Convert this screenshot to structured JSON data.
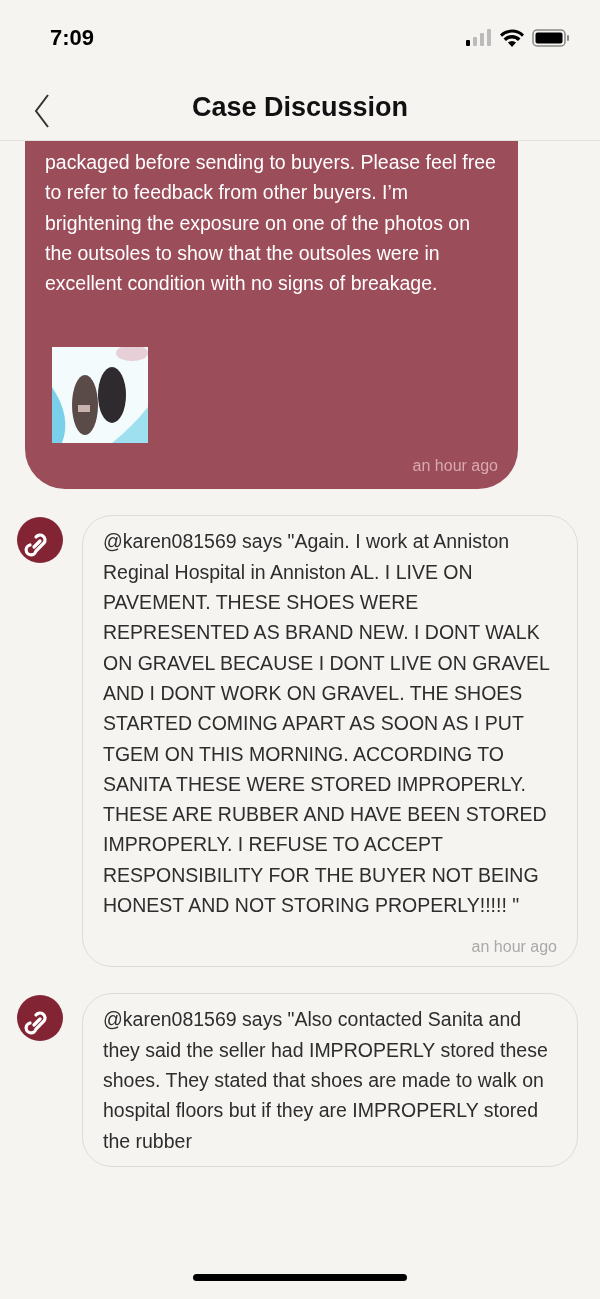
{
  "status_bar": {
    "time": "7:09"
  },
  "header": {
    "title": "Case Discussion"
  },
  "messages": [
    {
      "kind": "own",
      "text": "packaged before sending to buyers. Please feel free to refer to feedback from other buyers. I’m brightening the exposure on one of the photos on the outsoles to show that the outsoles were in excellent condition with no signs of breakage.",
      "time": "an hour ago"
    },
    {
      "kind": "other",
      "text": "@karen081569 says \"Again. I work at Anniston Reginal Hospital in Anniston AL. I LIVE ON PAVEMENT. THESE SHOES WERE REPRESENTED AS BRAND NEW. I DONT WALK ON GRAVEL BECAUSE I DONT LIVE ON GRAVEL AND I DONT WORK ON GRAVEL. THE SHOES STARTED COMING APART AS SOON AS I PUT TGEM ON THIS MORNING. ACCORDING TO SANITA THESE WERE STORED IMPROPERLY. THESE ARE RUBBER AND HAVE BEEN STORED IMPROPERLY. I REFUSE TO ACCEPT RESPONSIBILITY FOR THE BUYER NOT BEING HONEST AND NOT STORING PROPERLY!!!!! \"",
      "time": "an hour ago"
    },
    {
      "kind": "other",
      "text": "@karen081569 says \"Also contacted Sanita and they said the seller had IMPROPERLY stored these shoes. They stated that shoes are made to walk on hospital floors but if they are IMPROPERLY stored the rubber"
    }
  ]
}
